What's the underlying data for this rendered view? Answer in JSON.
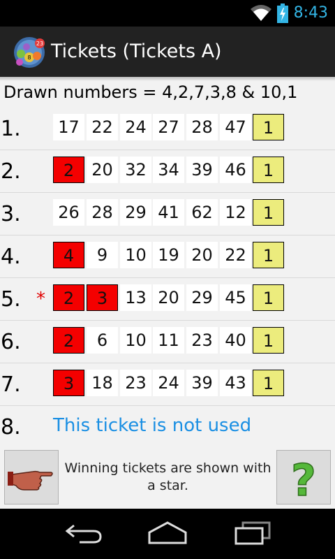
{
  "status_bar": {
    "time": "8:43",
    "icons": [
      "wifi-icon",
      "battery-charging-icon"
    ]
  },
  "app": {
    "title": "Tickets (Tickets A)",
    "logo_icon": "lottery-balls-logo-icon"
  },
  "drawn_numbers": "Drawn numbers = 4,2,7,3,8 & 10,1",
  "tickets": [
    {
      "label": "1.",
      "star": "",
      "numbers": [
        "17",
        "22",
        "24",
        "27",
        "28",
        "47"
      ],
      "bonus": "1",
      "hits": []
    },
    {
      "label": "2.",
      "star": "",
      "numbers": [
        "2",
        "20",
        "32",
        "34",
        "39",
        "46"
      ],
      "bonus": "1",
      "hits": [
        0
      ]
    },
    {
      "label": "3.",
      "star": "",
      "numbers": [
        "26",
        "28",
        "29",
        "41",
        "62",
        "12"
      ],
      "bonus": "1",
      "hits": []
    },
    {
      "label": "4.",
      "star": "",
      "numbers": [
        "4",
        "9",
        "10",
        "19",
        "20",
        "22"
      ],
      "bonus": "1",
      "hits": [
        0
      ]
    },
    {
      "label": "5.",
      "star": "*",
      "numbers": [
        "2",
        "3",
        "13",
        "20",
        "29",
        "45"
      ],
      "bonus": "1",
      "hits": [
        0,
        1
      ]
    },
    {
      "label": "6.",
      "star": "",
      "numbers": [
        "2",
        "6",
        "10",
        "11",
        "23",
        "40"
      ],
      "bonus": "1",
      "hits": [
        0
      ]
    },
    {
      "label": "7.",
      "star": "",
      "numbers": [
        "3",
        "18",
        "23",
        "24",
        "39",
        "43"
      ],
      "bonus": "1",
      "hits": [
        0
      ]
    }
  ],
  "unused_ticket": {
    "label": "8.",
    "text": "This ticket is not used"
  },
  "footer": {
    "hint": "Winning tickets are shown with a star.",
    "left_button_icon": "pointing-hand-icon",
    "right_button_icon": "help-question-mark-icon"
  },
  "navigation": {
    "back_icon": "back-icon",
    "home_icon": "home-icon",
    "recents_icon": "recent-apps-icon"
  },
  "colors": {
    "hit": "#f40000",
    "bonus": "#ecec7d",
    "accent": "#33b5e5",
    "unused_text": "#1a8fe3",
    "star": "#e00000"
  }
}
